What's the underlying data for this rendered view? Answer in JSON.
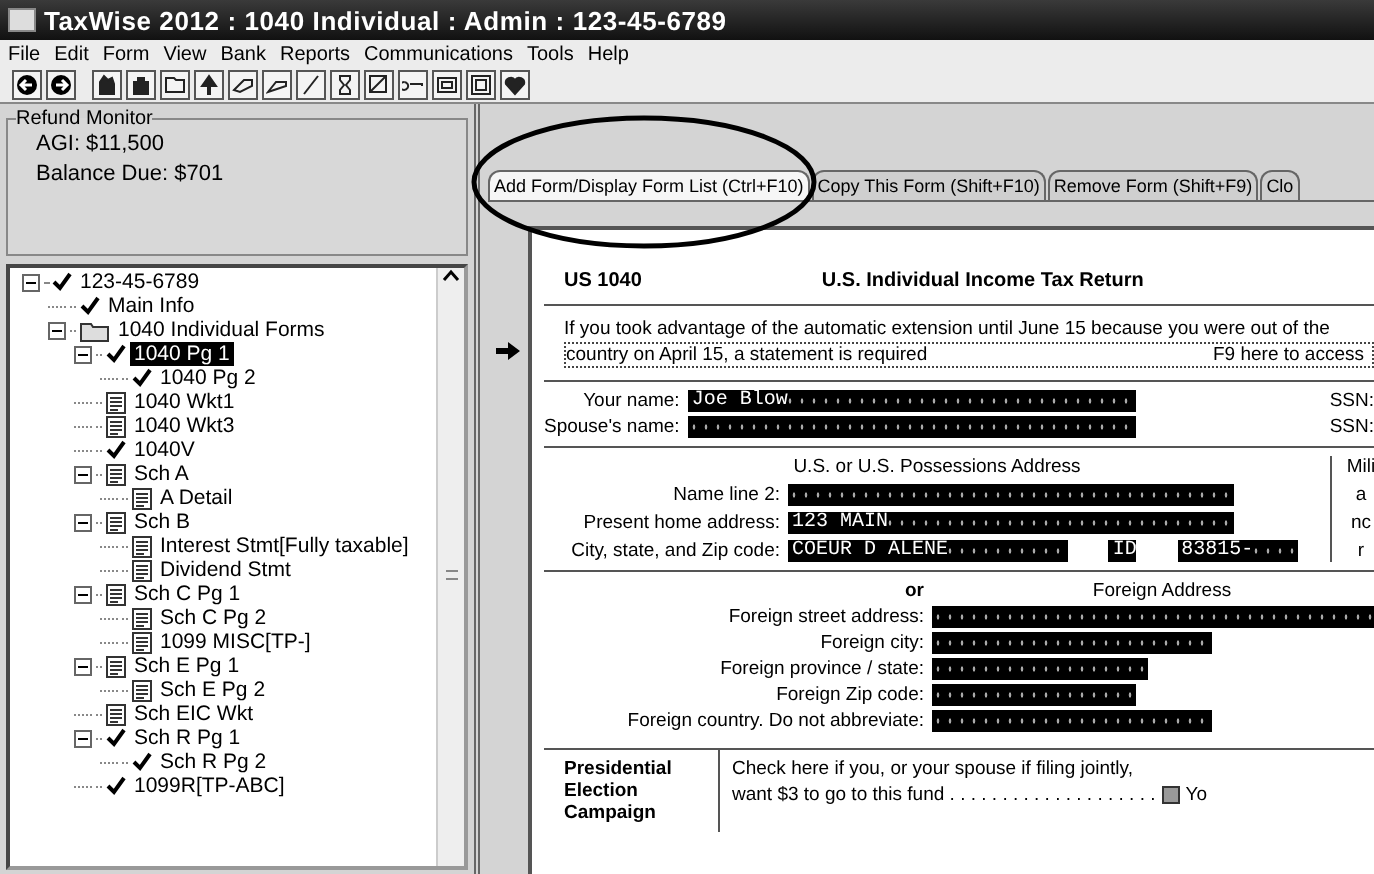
{
  "window": {
    "title": "TaxWise 2012 : 1040 Individual : Admin : 123-45-6789"
  },
  "menu": [
    "File",
    "Edit",
    "Form",
    "View",
    "Bank",
    "Reports",
    "Communications",
    "Tools",
    "Help"
  ],
  "refund_monitor": {
    "title": "Refund Monitor",
    "lines": [
      "AGI: $11,500",
      "Balance Due: $701"
    ]
  },
  "tree": [
    {
      "label": "123-45-6789",
      "kind": "check",
      "selected": false,
      "expanded": true,
      "children": [
        {
          "label": "Main Info",
          "kind": "check",
          "selected": false
        },
        {
          "label": "1040 Individual Forms",
          "kind": "folder",
          "selected": false,
          "expanded": true,
          "children": [
            {
              "label": "1040 Pg 1",
              "kind": "check",
              "selected": true,
              "expanded": true,
              "children": [
                {
                  "label": "1040 Pg 2",
                  "kind": "check",
                  "selected": false
                }
              ]
            },
            {
              "label": "1040 Wkt1",
              "kind": "form",
              "selected": false
            },
            {
              "label": "1040 Wkt3",
              "kind": "form",
              "selected": false
            },
            {
              "label": "1040V",
              "kind": "check",
              "selected": false
            },
            {
              "label": "Sch A",
              "kind": "form",
              "selected": false,
              "expanded": true,
              "children": [
                {
                  "label": "A Detail",
                  "kind": "form",
                  "selected": false
                }
              ]
            },
            {
              "label": "Sch B",
              "kind": "form",
              "selected": false,
              "expanded": true,
              "children": [
                {
                  "label": "Interest Stmt[Fully taxable]",
                  "kind": "form",
                  "selected": false
                },
                {
                  "label": "Dividend Stmt",
                  "kind": "form",
                  "selected": false
                }
              ]
            },
            {
              "label": "Sch C Pg 1",
              "kind": "form",
              "selected": false,
              "expanded": true,
              "children": [
                {
                  "label": "Sch C Pg 2",
                  "kind": "form",
                  "selected": false
                },
                {
                  "label": "1099 MISC[TP-]",
                  "kind": "form",
                  "selected": false
                }
              ]
            },
            {
              "label": "Sch E Pg 1",
              "kind": "form",
              "selected": false,
              "expanded": true,
              "children": [
                {
                  "label": "Sch E Pg 2",
                  "kind": "form",
                  "selected": false
                }
              ]
            },
            {
              "label": "Sch EIC Wkt",
              "kind": "form",
              "selected": false
            },
            {
              "label": "Sch R Pg 1",
              "kind": "check",
              "selected": false,
              "expanded": true,
              "children": [
                {
                  "label": "Sch R Pg 2",
                  "kind": "check",
                  "selected": false
                }
              ]
            },
            {
              "label": "1099R[TP-ABC]",
              "kind": "check",
              "selected": false
            }
          ]
        }
      ]
    }
  ],
  "tabs": [
    {
      "label": "Add Form/Display Form List (Ctrl+F10)",
      "selected": true
    },
    {
      "label": "Copy This Form (Shift+F10)",
      "selected": false
    },
    {
      "label": "Remove Form (Shift+F9)",
      "selected": false
    },
    {
      "label": "Clo",
      "selected": false
    }
  ],
  "form": {
    "code": "US 1040",
    "title": "U.S.  Individual Income Tax Return",
    "notice": [
      "If you took advantage of the automatic extension until June 15 because you were out of the",
      "country on April 15,  a statement is required",
      "F9 here to access"
    ],
    "names": [
      {
        "label": "Your name:",
        "value": "Joe Blow",
        "ssn": "SSN:"
      },
      {
        "label": "Spouse's name:",
        "ssn": "SSN:"
      }
    ],
    "us_address": {
      "heading": "U.S. or U.S. Possessions Address",
      "fields": [
        {
          "label": "Name line 2:"
        },
        {
          "label": "Present home address:",
          "values": [
            "123 MAIN"
          ]
        },
        {
          "label": "City,  state,  and Zip code:",
          "values": [
            "COEUR D ALENE",
            "ID",
            "83815-"
          ]
        }
      ],
      "side": [
        "Mili",
        "a",
        "nc",
        "r"
      ]
    },
    "foreign_address": {
      "or": "or",
      "heading": "Foreign Address",
      "fields": [
        {
          "label": "Foreign street address:"
        },
        {
          "label": "Foreign city:"
        },
        {
          "label": "Foreign province / state:"
        },
        {
          "label": "Foreign Zip code:"
        },
        {
          "label": "Foreign country.  Do not abbreviate:"
        }
      ]
    },
    "campaign": {
      "heading": "Presidential Election Campaign",
      "text": [
        "Check here if you,  or your spouse if filing jointly,",
        "want $3 to go to this fund . . . . . . . . . . . . . . . . . . . ."
      ],
      "checkbox": {
        "label": "Yo",
        "checked": false
      }
    }
  }
}
